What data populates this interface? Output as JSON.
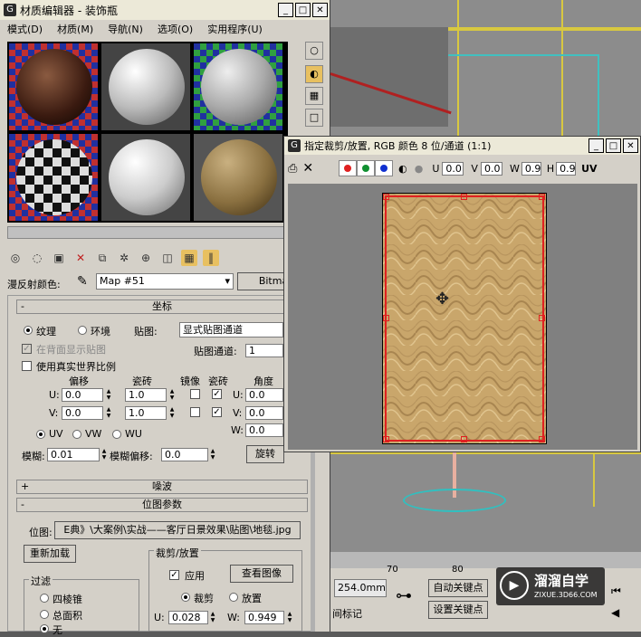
{
  "material_editor": {
    "title": "材质编辑器 - 装饰瓶",
    "menu": [
      "模式(D)",
      "材质(M)",
      "导航(N)",
      "选项(O)",
      "实用程序(U)"
    ],
    "diffuse_label": "漫反射颜色:",
    "map_name": "Map #51",
    "map_type_btn": "Bitma",
    "coords_rollout": "坐标",
    "texture_label": "纹理",
    "env_label": "环境",
    "mapping_label": "贴图:",
    "mapping_value": "显式贴图通道",
    "show_back_label": "在背面显示贴图",
    "map_channel_label": "贴图通道:",
    "map_channel_value": "1",
    "real_world_label": "使用真实世界比例",
    "offset_label": "偏移",
    "tiling_label": "瓷砖",
    "mirror_label": "镜像",
    "tile_label": "瓷砖",
    "angle_label": "角度",
    "u_label": "U:",
    "v_label": "V:",
    "w_label": "W:",
    "u_offset": "0.0",
    "v_offset": "0.0",
    "u_tiling": "1.0",
    "v_tiling": "1.0",
    "u_angle": "0.0",
    "v_angle": "0.0",
    "w_angle": "0.0",
    "uv_label": "UV",
    "vw_label": "VW",
    "wu_label": "WU",
    "blur_label": "模糊:",
    "blur_value": "0.01",
    "blur_offset_label": "模糊偏移:",
    "blur_offset_value": "0.0",
    "rotate_btn": "旋转",
    "noise_rollout": "噪波",
    "bitmap_rollout": "位图参数",
    "bitmap_label": "位图:",
    "bitmap_path": "E典》\\大案例\\实战——客厅日景效果\\贴图\\地毯.jpg",
    "reload_btn": "重新加载",
    "crop_group": "裁剪/放置",
    "apply_label": "应用",
    "view_image_btn": "查看图像",
    "crop_label": "裁剪",
    "place_label": "放置",
    "filter_group": "过滤",
    "filter_opt1": "四棱锥",
    "filter_opt2": "总面积",
    "filter_opt3": "无",
    "crop_u_label": "U:",
    "crop_u_value": "0.028",
    "crop_w_label": "W:",
    "crop_w_value": "0.949"
  },
  "crop_window": {
    "title": "指定裁剪/放置, RGB 颜色 8 位/通道 (1:1)",
    "u_label": "U",
    "u_value": "0.0",
    "v_label": "V",
    "v_value": "0.0",
    "w_label": "W",
    "w_value": "0.9",
    "h_label": "H",
    "h_value": "0.9",
    "uv_label": "UV"
  },
  "status": {
    "value_mm": "254.0mm",
    "ruler_70": "70",
    "ruler_80": "80",
    "auto_key": "自动关键点",
    "set_key": "设置关键点",
    "time_tag": "间标记"
  },
  "watermark": {
    "text": "溜溜自学",
    "sub": "ZIXUE.3D66.COM"
  },
  "colors": {
    "accent_red": "#e02020",
    "carpet": "#c9a66b",
    "panel": "#d4d0c8"
  }
}
